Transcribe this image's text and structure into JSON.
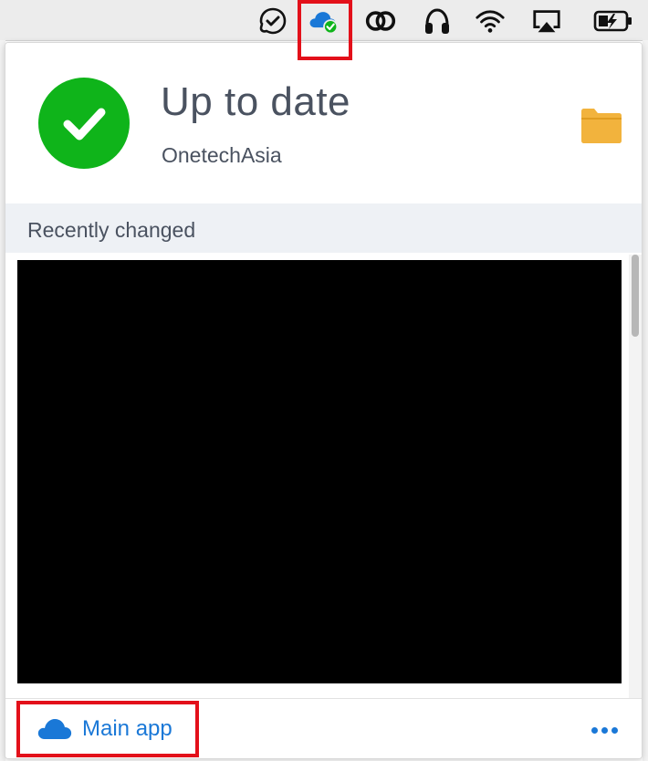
{
  "menubar": {
    "icons": [
      {
        "name": "skype-status-icon"
      },
      {
        "name": "cloud-sync-icon"
      },
      {
        "name": "creative-cloud-icon"
      },
      {
        "name": "headphones-icon"
      },
      {
        "name": "wifi-icon"
      },
      {
        "name": "airplay-icon"
      },
      {
        "name": "battery-charging-icon"
      }
    ]
  },
  "status": {
    "title": "Up to date",
    "subtitle": "OnetechAsia",
    "icon": "check-icon",
    "color": "#0fb41a"
  },
  "recent": {
    "header": "Recently changed"
  },
  "footer": {
    "main_app_label": "Main app",
    "more_icon": "more-dots-icon",
    "accent": "#1a78d7"
  },
  "highlight_color": "#e3101a"
}
